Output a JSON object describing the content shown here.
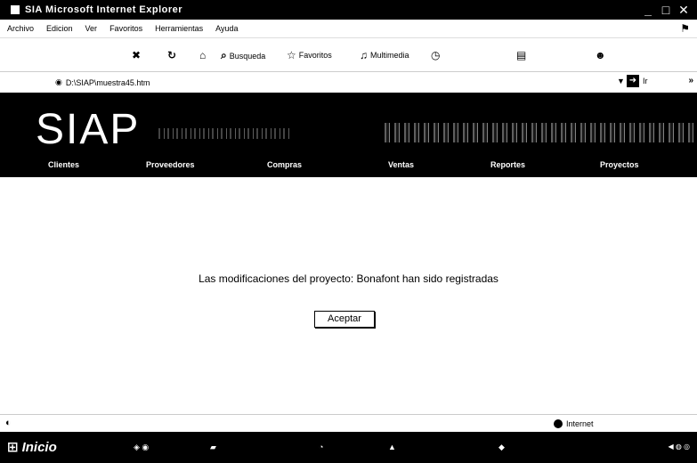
{
  "window": {
    "title": "SIA   Microsoft Internet Explorer",
    "buttons": [
      "_",
      "□",
      "✕"
    ]
  },
  "menu": {
    "items": [
      "Archivo",
      "Edicion",
      "Ver",
      "Favoritos",
      "Herramientas",
      "Ayuda"
    ]
  },
  "toolbar": {
    "search_label": "Busqueda",
    "favorites_label": "Favoritos",
    "media_label": "Multimedia"
  },
  "address": {
    "url": "D:\\SIAP\\muestra45.htm",
    "go_label": "Ir"
  },
  "site": {
    "logo": "SIAP",
    "nav": [
      "Clientes",
      "Proveedores",
      "Compras",
      "Ventas",
      "Reportes",
      "Proyectos"
    ]
  },
  "content": {
    "message": "Las modificaciones del proyecto: Bonafont han sido registradas",
    "accept_label": "Aceptar"
  },
  "status": {
    "zone": "Internet"
  },
  "taskbar": {
    "start_label": "Inicio"
  },
  "colors": {
    "header_bg": "#000000",
    "content_bg": "#ffffff"
  }
}
